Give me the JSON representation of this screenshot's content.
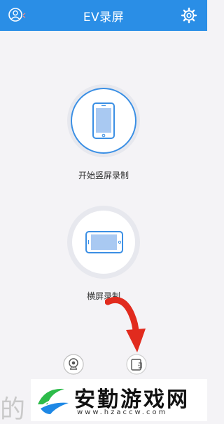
{
  "app": {
    "title": "EV录屏"
  },
  "modes": {
    "portrait_label": "开始竖屏录制",
    "landscape_label": "横屏录制"
  },
  "icons": {
    "user": "user-icon",
    "settings": "gear-icon",
    "camera": "camera-icon",
    "folder": "folder-icon",
    "arrow": "red-arrow-icon"
  },
  "colors": {
    "header": "#2a8ee6",
    "accent": "#3b8fe4",
    "screen": "#a9c9f2",
    "arrow": "#e12b1e"
  },
  "watermark": {
    "brand": "安勤游戏网",
    "url": "www.hzaccw.com",
    "corner_text": "的"
  }
}
